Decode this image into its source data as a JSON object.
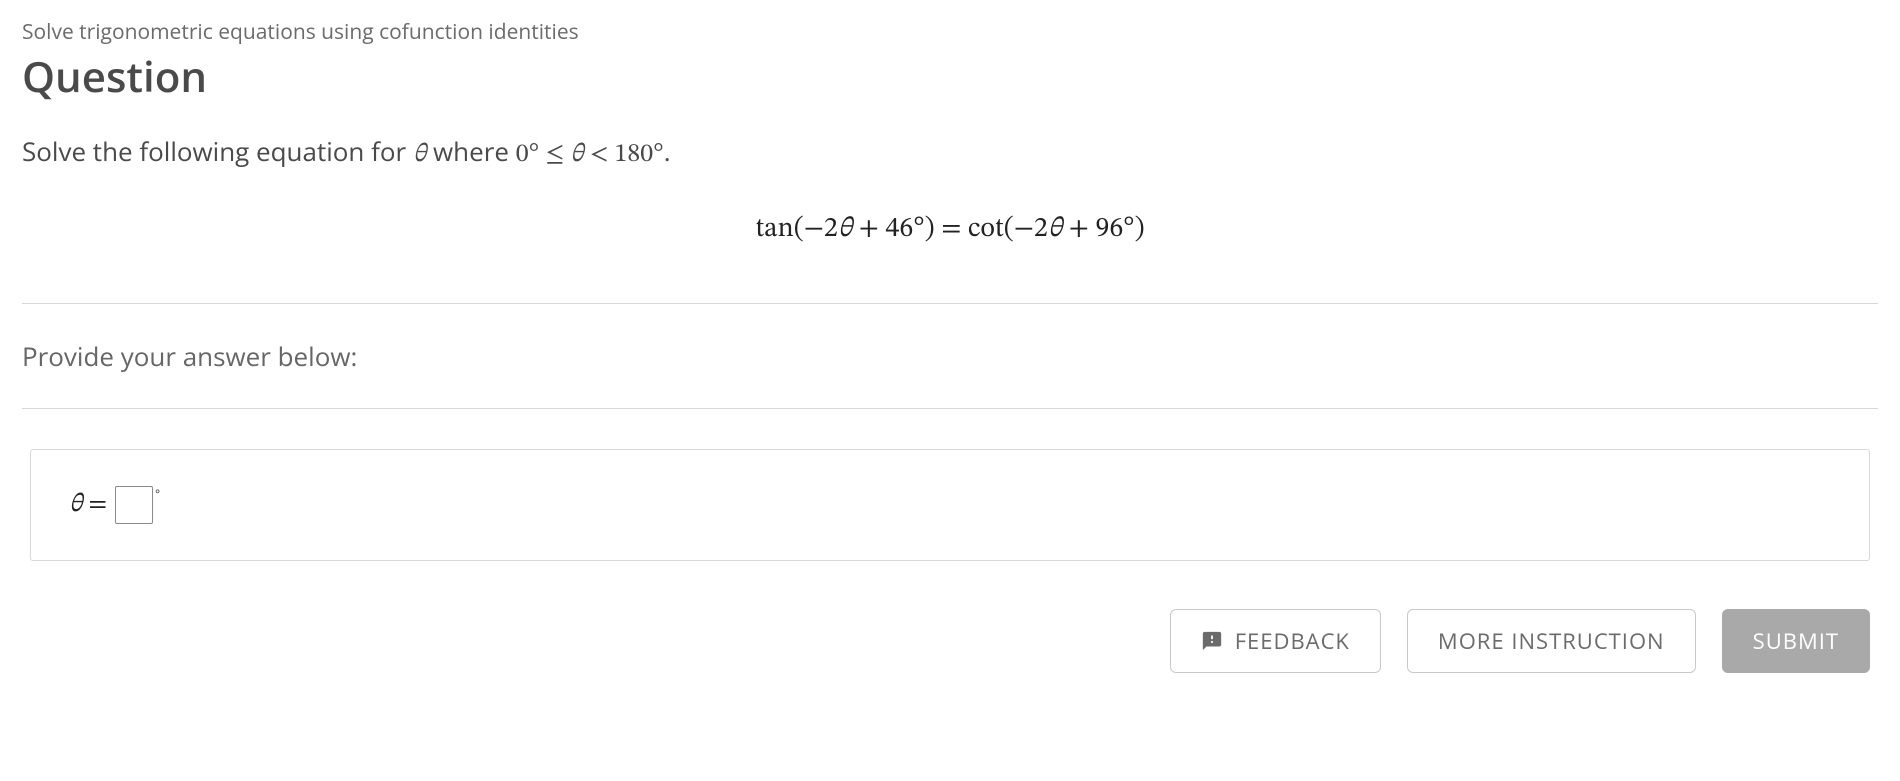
{
  "topic": "Solve trigonometric equations using cofunction identities",
  "heading": "Question",
  "prompt": {
    "lead": "Solve the following equation for ",
    "var": "θ",
    "mid": " where ",
    "range_a": "0°",
    "rel1": " ≤ ",
    "var2": "θ",
    "rel2": " < ",
    "range_b": "180°",
    "tail": "."
  },
  "equation": {
    "lhs_fn": "tan",
    "lhs_open": "(−2",
    "lhs_var": "θ",
    "lhs_rest": " + 46°)",
    "eq": " = ",
    "rhs_fn": "cot",
    "rhs_open": "(−2",
    "rhs_var": "θ",
    "rhs_rest": " + 96°)"
  },
  "provide_label": "Provide your answer below:",
  "answer": {
    "var": "θ",
    "eq": "=",
    "value": "",
    "unit": "°"
  },
  "buttons": {
    "feedback": "FEEDBACK",
    "more": "MORE INSTRUCTION",
    "submit": "SUBMIT"
  }
}
